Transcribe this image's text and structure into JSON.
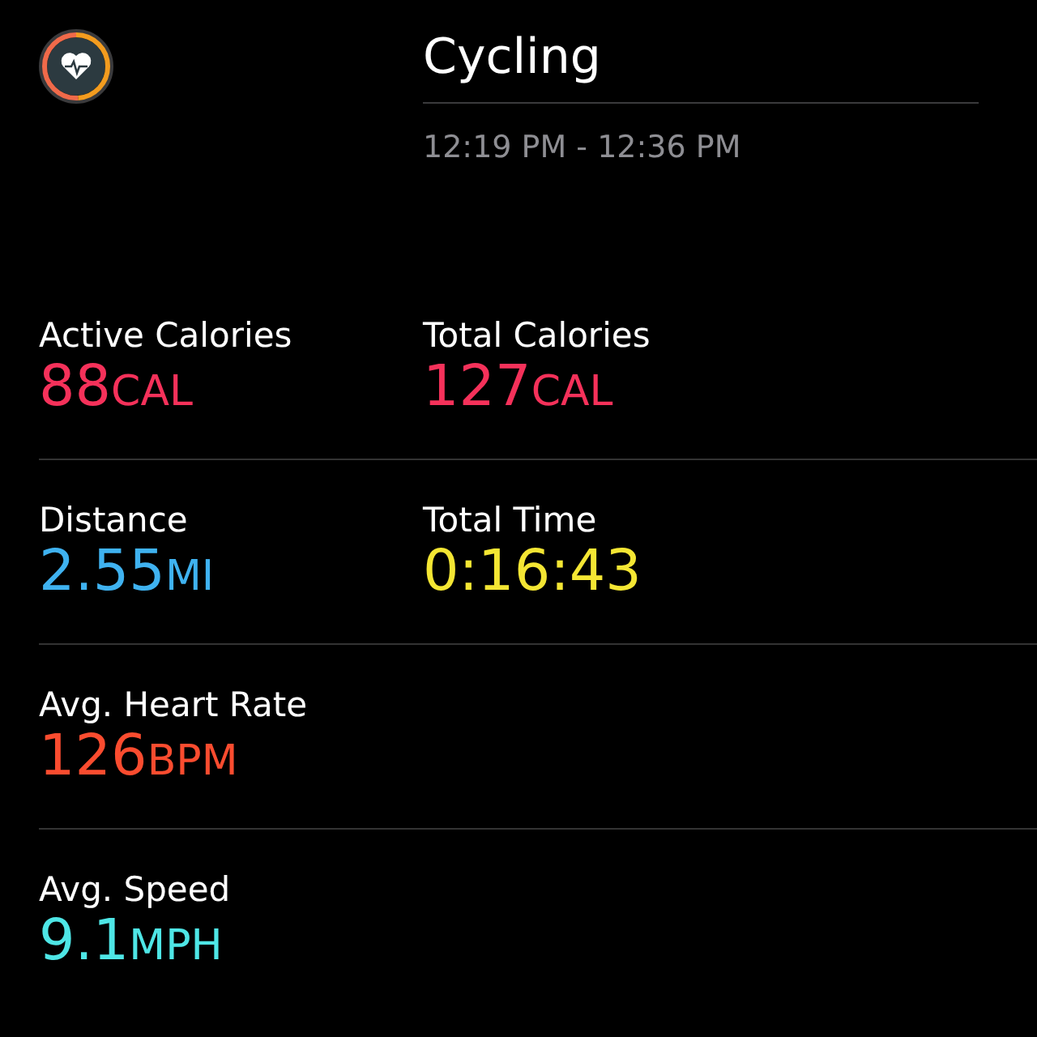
{
  "header": {
    "title": "Cycling",
    "time_range": "12:19 PM - 12:36 PM"
  },
  "rows": [
    {
      "metrics": [
        {
          "label": "Active Calories",
          "value": "88",
          "unit": "CAL",
          "color": "#f5315a"
        },
        {
          "label": "Total Calories",
          "value": "127",
          "unit": "CAL",
          "color": "#f5315a"
        }
      ]
    },
    {
      "metrics": [
        {
          "label": "Distance",
          "value": "2.55",
          "unit": "MI",
          "color": "#3fb2f0"
        },
        {
          "label": "Total Time",
          "value": "0:16:43",
          "color": "#f4e633"
        }
      ]
    },
    {
      "metrics": [
        {
          "label": "Avg. Heart Rate",
          "value": "126",
          "unit": "BPM",
          "color": "#fb4c2f"
        }
      ]
    },
    {
      "metrics": [
        {
          "label": "Avg. Speed",
          "value": "9.1",
          "unit": "MPH",
          "color": "#4ee6e6"
        }
      ]
    }
  ]
}
